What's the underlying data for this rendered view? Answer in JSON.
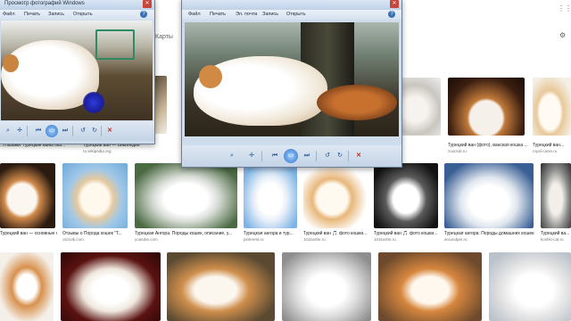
{
  "search_page": {
    "maps_label": "Карты",
    "results": [
      {
        "caption": "",
        "source": ""
      },
      {
        "caption": "Турецкий ван — Википедия",
        "source": "ru.wikipedia.org"
      },
      {
        "caption": "Турецкий ван (фото), ванская кошка ...",
        "source": "zooclub.ru"
      },
      {
        "caption": "Турецкий ван...",
        "source": "royal-canin.ru"
      },
      {
        "caption": "Турецкий ван — основные хар...",
        "source": ""
      },
      {
        "caption": "Отзывы о Порода кошек \"Т...",
        "source": "otzovik.com"
      },
      {
        "caption": "Турецкая Ангора. Породы кошек, описание, у...",
        "source": "youtube.com"
      },
      {
        "caption": "Турецкая ангора и тур...",
        "source": "pinterest.ru"
      },
      {
        "caption": "Турецкий ван 🎵 фото кошки...",
        "source": "101koshe.ru"
      },
      {
        "caption": "Турецкий ван 🎵 фото кошки...",
        "source": "101koshe.ru"
      },
      {
        "caption": "Турецкая ангора: Породы домашних кошек: Ту...",
        "source": "aroundpet.ru"
      },
      {
        "caption": "Турецкий ва...",
        "source": "koshki-cat.ru"
      }
    ],
    "left_caption": "Турецкий ван — основные хар...",
    "left_caption2": "...глазами: турецкие ваны ока..."
  },
  "viewer_left": {
    "title": "Просмотр фотографий Windows",
    "menus": [
      "Файл",
      "Печать",
      "Запись",
      "Открыть"
    ],
    "help": "?"
  },
  "viewer_right": {
    "menus": [
      "Файл",
      "Печать",
      "Эл. почта",
      "Запись",
      "Открыть"
    ],
    "help": "?"
  },
  "colors": {
    "window_frame": "#6b7f99",
    "toolbar": "#c3d3e6",
    "close_red": "#c42b1c",
    "accent_blue": "#2f73c7"
  }
}
